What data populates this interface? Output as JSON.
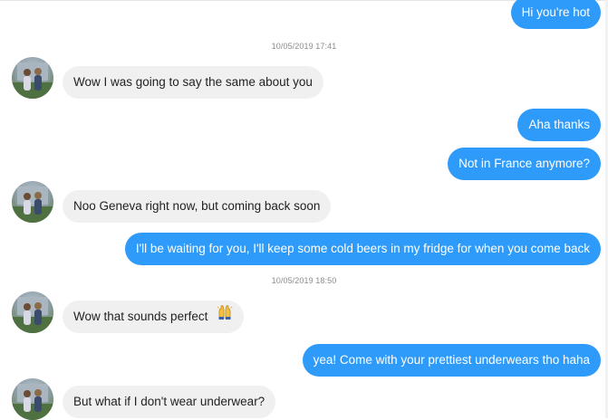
{
  "conversation": {
    "timestamps": [
      "10/05/2019 17:41",
      "10/05/2019 18:50"
    ],
    "messages": [
      {
        "side": "sent",
        "text": "Hi you're hot"
      },
      {
        "side": "received",
        "text": "Wow I was going to say the same about you"
      },
      {
        "side": "sent",
        "text": "Aha thanks"
      },
      {
        "side": "sent",
        "text": "Not in France anymore?"
      },
      {
        "side": "received",
        "text": "Noo Geneva right now, but coming back soon"
      },
      {
        "side": "sent",
        "text": "I'll be waiting for you, I'll keep some cold beers in my fridge for when you come back"
      },
      {
        "side": "received",
        "text": "Wow that sounds perfect",
        "emoji": "raising-hands-emoji"
      },
      {
        "side": "sent",
        "text": "yea! Come with your prettiest underwears tho haha"
      },
      {
        "side": "received",
        "text": "But what if I don't wear underwear?"
      }
    ]
  },
  "colors": {
    "sent_bubble": "#2e9bfb",
    "received_bubble": "#f0f0f0",
    "sent_text": "#ffffff",
    "received_text": "#222222",
    "timestamp_text": "#8c8c8c"
  }
}
